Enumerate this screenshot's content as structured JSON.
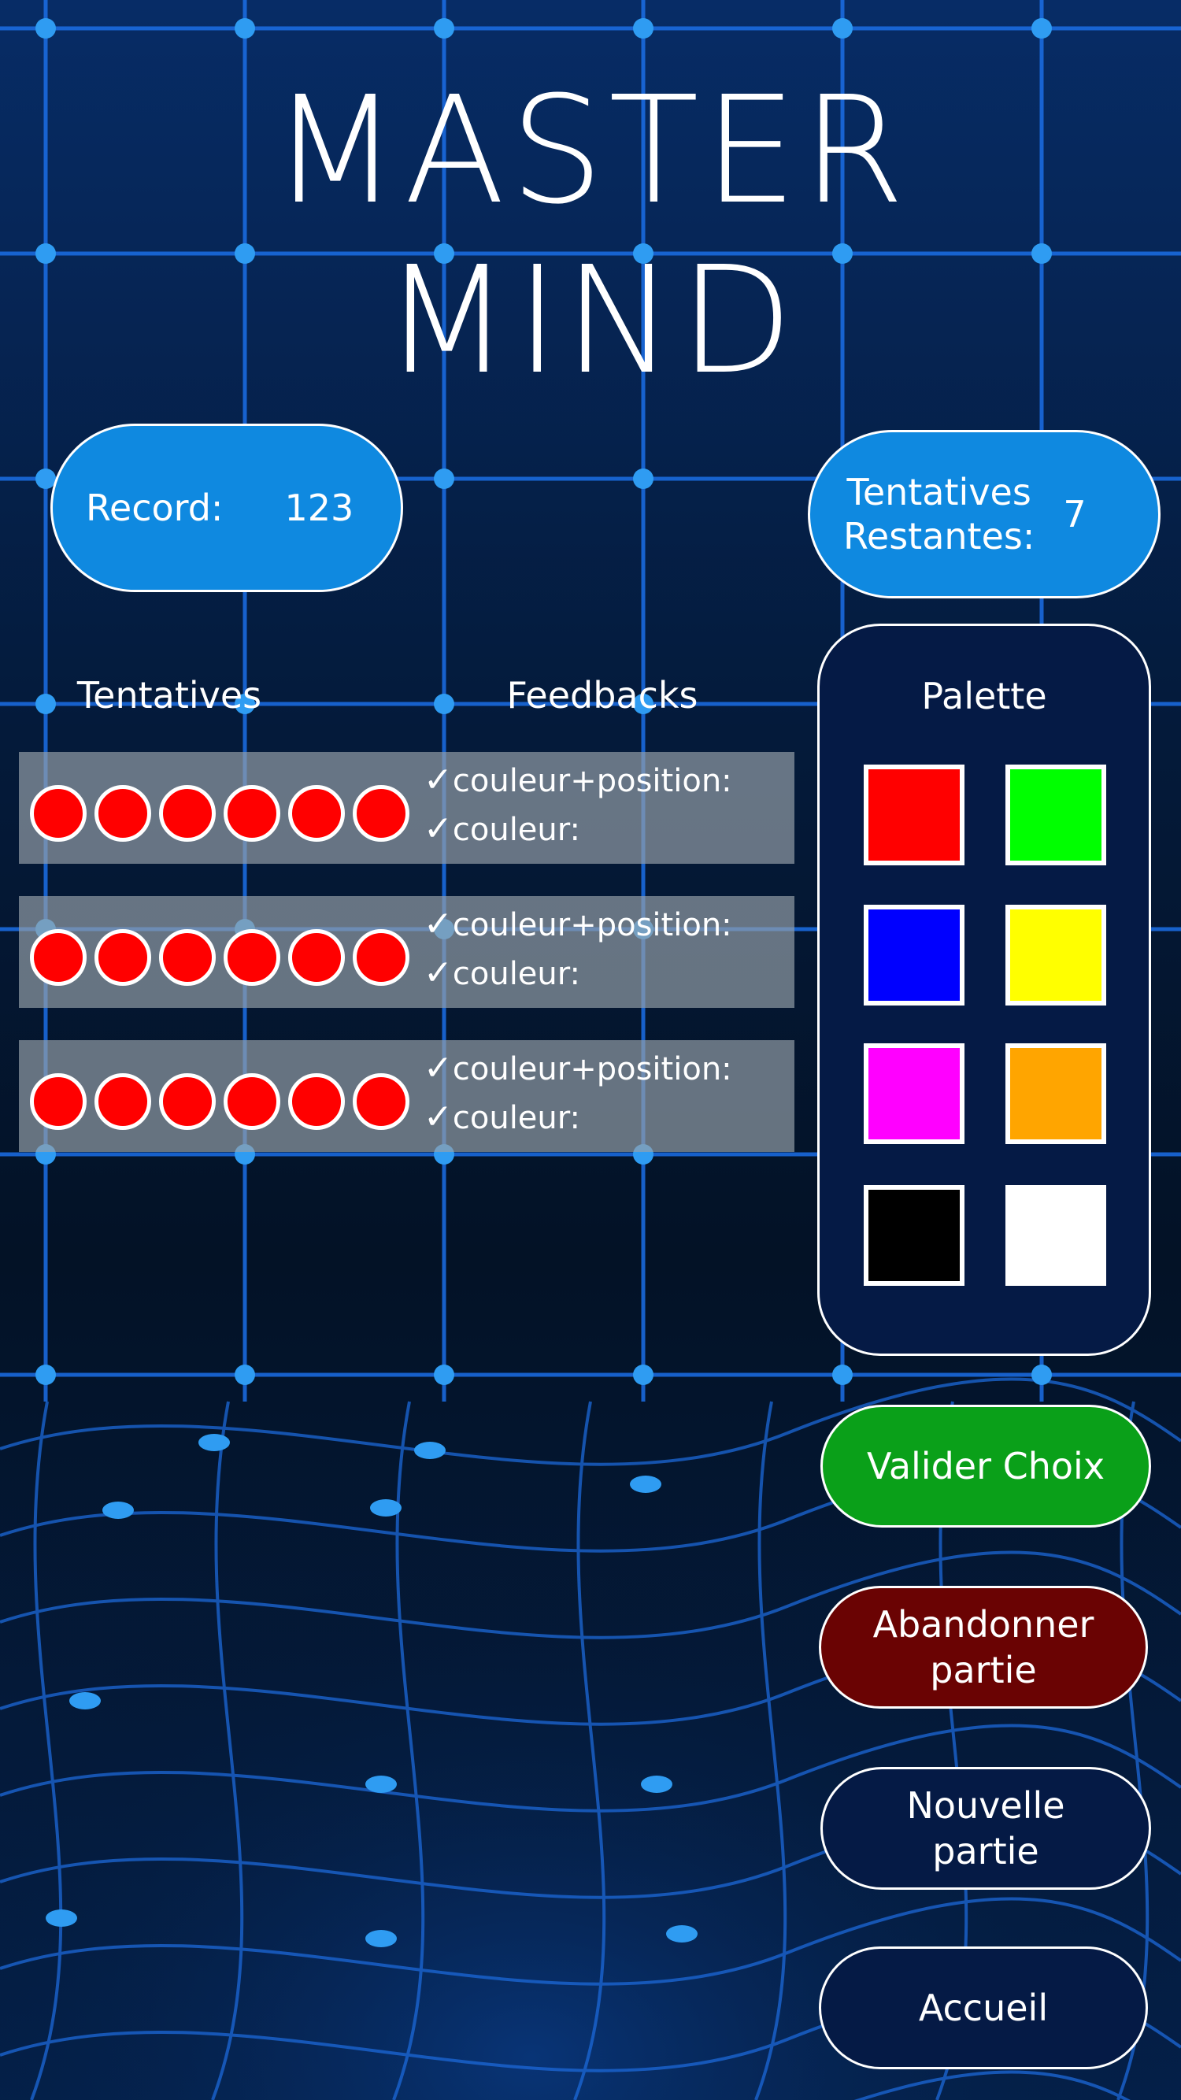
{
  "title": {
    "line1": "MASTER",
    "line2": "MIND"
  },
  "record": {
    "label": "Record:",
    "value": "123"
  },
  "remaining": {
    "label_line1": "Tentatives",
    "label_line2": "Restantes:",
    "value": "7"
  },
  "columns": {
    "tentatives": "Tentatives",
    "feedbacks": "Feedbacks"
  },
  "feedback_labels": {
    "check": "✓",
    "color_position": "couleur+position:",
    "color": "couleur:"
  },
  "attempts": [
    {
      "pegs": [
        "#ff0000",
        "#ff0000",
        "#ff0000",
        "#ff0000",
        "#ff0000",
        "#ff0000"
      ]
    },
    {
      "pegs": [
        "#ff0000",
        "#ff0000",
        "#ff0000",
        "#ff0000",
        "#ff0000",
        "#ff0000"
      ]
    },
    {
      "pegs": [
        "#ff0000",
        "#ff0000",
        "#ff0000",
        "#ff0000",
        "#ff0000",
        "#ff0000"
      ]
    }
  ],
  "palette": {
    "title": "Palette",
    "colors": [
      "#ff0000",
      "#00ff00",
      "#0000ff",
      "#ffff00",
      "#ff00ff",
      "#ffa500",
      "#000000",
      "#ffffff"
    ]
  },
  "buttons": {
    "validate": "Valider Choix",
    "abandon_line1": "Abandonner",
    "abandon_line2": "partie",
    "new_line1": "Nouvelle",
    "new_line2": "partie",
    "home": "Accueil"
  },
  "colors": {
    "accent_blue": "#0f89e0",
    "validate_green": "#0aa019",
    "abandon_red": "#6a0303",
    "panel_navy": "#051a45"
  }
}
